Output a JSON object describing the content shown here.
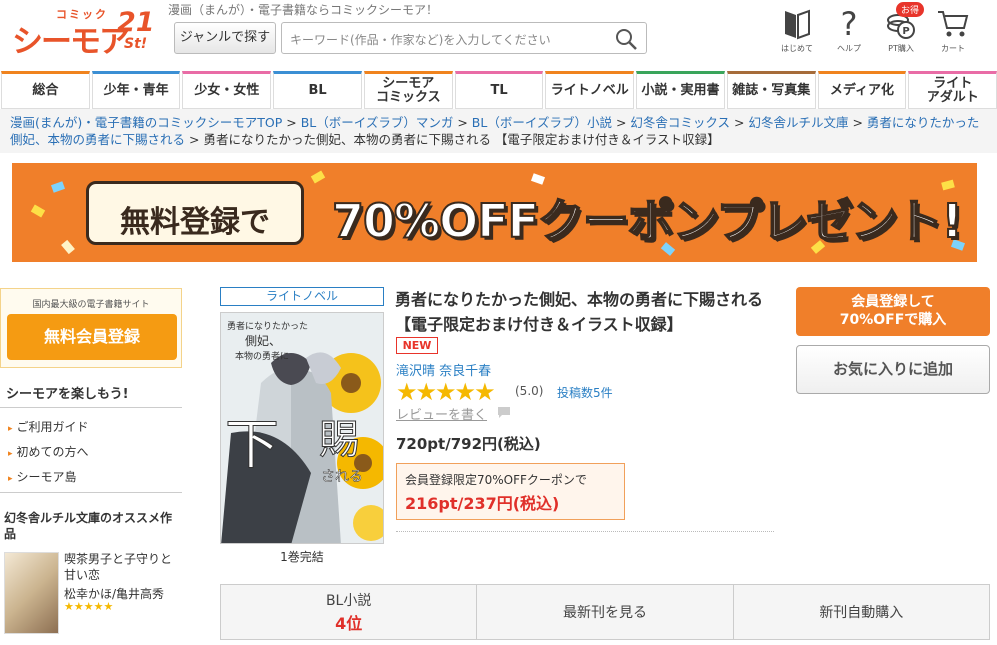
{
  "header": {
    "logo_top": "コミック",
    "logo_main": "シーモア",
    "logo_num": "21",
    "logo_st": "St!",
    "tagline": "漫画（まんが）・電子書籍ならコミックシーモア！",
    "genre_button": "ジャンルで探す",
    "search_placeholder": "キーワード(作品・作家など)を入力してください",
    "icons": [
      {
        "label": "はじめて",
        "icon": "book-icon"
      },
      {
        "label": "ヘルプ",
        "icon": "question-icon"
      },
      {
        "label": "PT購入",
        "icon": "coin-icon",
        "badge": "お得"
      },
      {
        "label": "カート",
        "icon": "cart-icon"
      }
    ]
  },
  "nav": {
    "tabs": [
      "総合",
      "少年・青年",
      "少女・女性",
      "BL",
      "シーモア\nコミックス",
      "TL",
      "ライトノベル",
      "小説・実用書",
      "雑誌・写真集",
      "メディア化",
      "ライト\nアダルト"
    ],
    "tab_colors": [
      "#f0831e",
      "#3b8fd4",
      "#e96ca6",
      "#3b8fd4",
      "#f0831e",
      "#e96ca6",
      "#f0831e",
      "#3aa55b",
      "#a66c3a",
      "#f0831e",
      "#e96ca6"
    ]
  },
  "breadcrumb": [
    "漫画(まんが)・電子書籍のコミックシーモアTOP",
    "BL（ボーイズラブ）マンガ",
    "BL（ボーイズラブ）小説",
    "幻冬舎コミックス",
    "幻冬舎ルチル文庫",
    "勇者になりたかった側妃、本物の勇者に下賜される",
    "勇者になりたかった側妃、本物の勇者に下賜される 【電子限定おまけ付き＆イラスト収録】"
  ],
  "banner": {
    "left_text": "無料登録で",
    "main_text": "70%OFFクーポンプレゼント!"
  },
  "sidebar": {
    "box_text": "国内最大級の電子書籍サイト",
    "register_button": "無料会員登録",
    "enjoy_heading": "シーモアを楽しもう!",
    "links": [
      "ご利用ガイド",
      "初めての方へ",
      "シーモア島"
    ],
    "recommend_heading": "幻冬舎ルチル文庫のオススメ作品",
    "recommend": {
      "title": "喫茶男子と子守りと甘い恋",
      "authors": "松幸かほ/亀井高秀",
      "stars": "★★★★★"
    }
  },
  "product": {
    "genre": "ライトノベル",
    "volume": "1巻完結",
    "title": "勇者になりたかった側妃、本物の勇者に下賜される 【電子限定おまけ付き＆イラスト収録】",
    "new_badge": "NEW",
    "authors": [
      "滝沢晴",
      "奈良千春"
    ],
    "stars": "★★★★★",
    "score": "(5.0)",
    "review_count": "投稿数5件",
    "review_link": "レビューを書く",
    "price": "720pt/792円(税込)",
    "coupon_text": "会員登録限定70%OFFクーポンで",
    "coupon_price": "216pt/237円(税込)",
    "cover_title_a": "勇者になりたかった",
    "cover_title_b": "側妃、",
    "cover_title_c": "本物の勇者に",
    "cover_big1": "下",
    "cover_big2": "賜",
    "cover_sub": "される"
  },
  "actions": {
    "buy_line1": "会員登録して",
    "buy_line2": "70%OFFで購入",
    "favorite": "お気に入りに追加"
  },
  "bottom": {
    "rank_label": "BL小説",
    "rank_value": "4位",
    "latest": "最新刊を見る",
    "auto": "新刊自動購入"
  },
  "colors": {
    "accent": "#f07f2a",
    "link": "#2a7fc4",
    "price_red": "#e0302a"
  }
}
